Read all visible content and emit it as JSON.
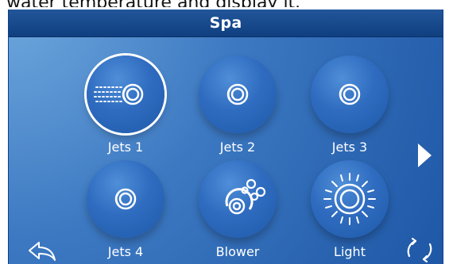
{
  "top_caption": "water temperature and display it.",
  "header": {
    "title": "Spa"
  },
  "controls": [
    {
      "label": "Jets 1",
      "icon": "jets-icon",
      "selected": true
    },
    {
      "label": "Jets 2",
      "icon": "jets-icon",
      "selected": false
    },
    {
      "label": "Jets 3",
      "icon": "jets-icon",
      "selected": false
    },
    {
      "label": "Jets 4",
      "icon": "jets-icon",
      "selected": false
    },
    {
      "label": "Blower",
      "icon": "blower-icon",
      "selected": false
    },
    {
      "label": "Light",
      "icon": "light-icon",
      "selected": false
    }
  ],
  "navigation": {
    "next_icon": "next-arrow-icon",
    "back_icon": "back-arrow-icon",
    "refresh_icon": "refresh-icon"
  },
  "colors": {
    "background_light": "#6ea7dd",
    "background_dark": "#1e57a6",
    "button_blue": "#2f6cc0",
    "title_bar": "#0f3f80",
    "text": "#ffffff"
  }
}
